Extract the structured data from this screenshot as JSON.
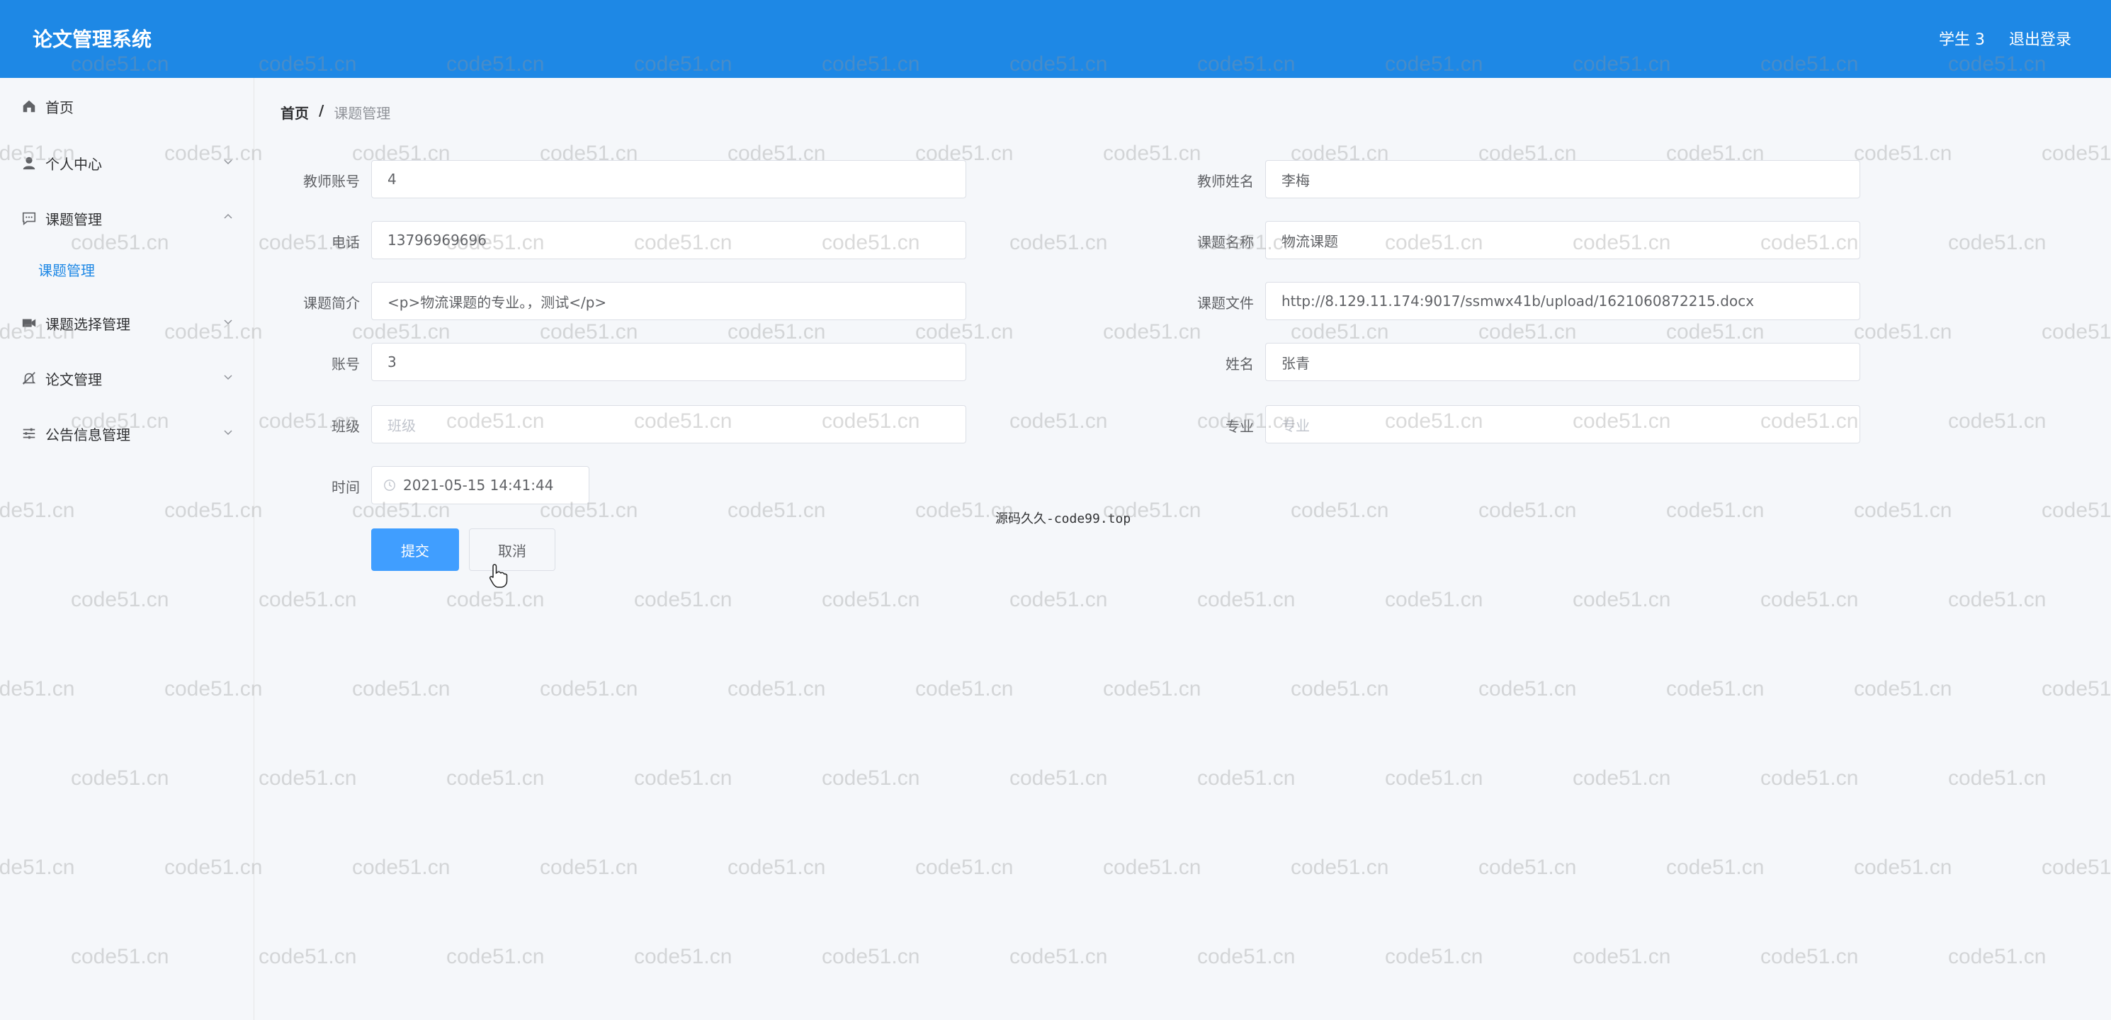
{
  "header": {
    "app_title": "论文管理系统",
    "user_label": "学生 3",
    "logout_label": "退出登录"
  },
  "sidebar": {
    "items": [
      {
        "label": "首页",
        "icon": "home-icon"
      },
      {
        "label": "个人中心",
        "icon": "user-icon"
      },
      {
        "label": "课题管理",
        "icon": "chat-icon",
        "expanded": true
      },
      {
        "label": "课题选择管理",
        "icon": "video-icon"
      },
      {
        "label": "论文管理",
        "icon": "bell-off-icon"
      },
      {
        "label": "公告信息管理",
        "icon": "sliders-icon"
      }
    ],
    "submenu_active": "课题管理"
  },
  "breadcrumb": {
    "home": "首页",
    "separator": "/",
    "current": "课题管理"
  },
  "form": {
    "teacher_account": {
      "label": "教师账号",
      "value": "4"
    },
    "teacher_name": {
      "label": "教师姓名",
      "value": "李梅"
    },
    "phone": {
      "label": "电话",
      "value": "13796969696"
    },
    "topic_name": {
      "label": "课题名称",
      "value": "物流课题"
    },
    "topic_intro": {
      "label": "课题简介",
      "value": "<p>物流课题的专业。，测试</p>"
    },
    "topic_file": {
      "label": "课题文件",
      "value": "http://8.129.11.174:9017/ssmwx41b/upload/1621060872215.docx"
    },
    "account": {
      "label": "账号",
      "value": "3"
    },
    "name": {
      "label": "姓名",
      "value": "张青"
    },
    "class": {
      "label": "班级",
      "placeholder": "班级"
    },
    "major": {
      "label": "专业",
      "placeholder": "专业"
    },
    "time": {
      "label": "时间",
      "value": "2021-05-15 14:41:44"
    },
    "submit_label": "提交",
    "cancel_label": "取消"
  },
  "center_note": "源码久久-code99.top",
  "watermark_text": "code51.cn",
  "colors": {
    "header_bg": "#1e88e5",
    "primary": "#409eff"
  }
}
